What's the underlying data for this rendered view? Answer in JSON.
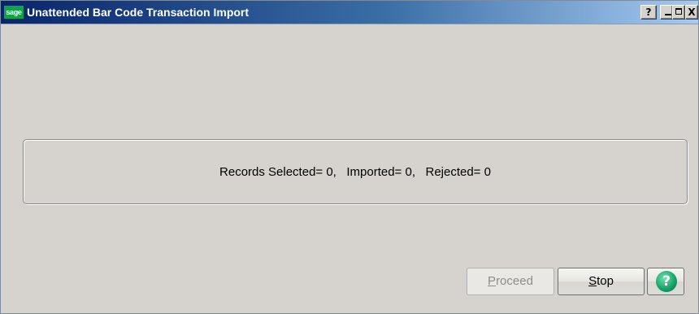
{
  "window": {
    "logo_text": "sage",
    "title": "Unattended Bar Code Transaction Import",
    "help_glyph": "?",
    "close_glyph": "X"
  },
  "status": {
    "text": "Records Selected= 0,   Imported= 0,   Rejected= 0"
  },
  "buttons": {
    "proceed_first": "P",
    "proceed_rest": "roceed",
    "stop_first": "S",
    "stop_rest": "top",
    "help_glyph": "?"
  },
  "icons": {
    "help": "help-circle-icon",
    "minimize": "minimize-icon",
    "maximize": "maximize-icon",
    "close": "close-icon"
  },
  "colors": {
    "titlebar_start": "#08246b",
    "titlebar_end": "#a6caf0",
    "sage_green": "#12a34a",
    "help_green": "#18a56b",
    "window_bg": "#d6d3ce"
  }
}
